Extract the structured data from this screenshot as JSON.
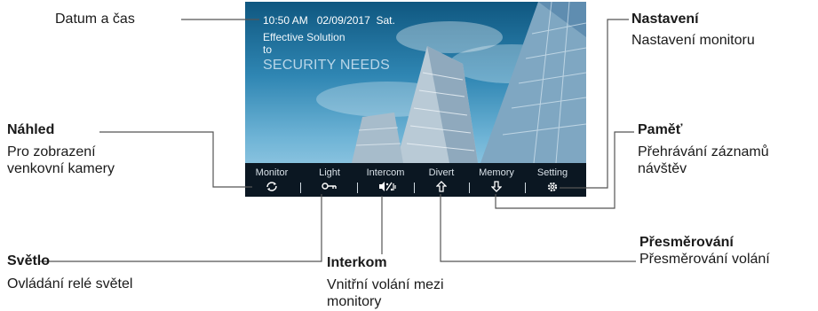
{
  "screen": {
    "time": "10:50 AM",
    "date": "02/09/2017",
    "day": "Sat.",
    "slogan_line1": "Effective Solution",
    "slogan_line2": "to",
    "slogan_line3": "SECURITY NEEDS",
    "menu": [
      {
        "label": "Monitor",
        "icon": "camera-rotate-icon"
      },
      {
        "label": "Light",
        "icon": "key-icon"
      },
      {
        "label": "Intercom",
        "icon": "intercom-icon"
      },
      {
        "label": "Divert",
        "icon": "arrow-up-icon"
      },
      {
        "label": "Memory",
        "icon": "arrow-down-icon"
      },
      {
        "label": "Setting",
        "icon": "gear-icon"
      }
    ]
  },
  "callouts": {
    "datum": "Datum a čas",
    "nastaveni_title": "Nastavení",
    "nastaveni_desc": "Nastavení monitoru",
    "nahled_title": "Náhled",
    "nahled_desc1": "Pro zobrazení",
    "nahled_desc2": "venkovní kamery",
    "pamet_title": "Paměť",
    "pamet_desc1": "Přehrávání záznamů",
    "pamet_desc2": "návštěv",
    "presmerovani_title": "Přesměrování",
    "presmerovani_desc": "Přesměrování volání",
    "svetlo_title": "Světlo",
    "svetlo_desc": "Ovládání relé světel",
    "interkom_title": "Interkom",
    "interkom_desc1": "Vnitřní volání mezi",
    "interkom_desc2": "monitory"
  },
  "colors": {
    "sky_top": "#0f5780",
    "sky_bottom": "#a9d4ea",
    "menu_bar": "#0b1722",
    "leader_line": "#555555"
  }
}
